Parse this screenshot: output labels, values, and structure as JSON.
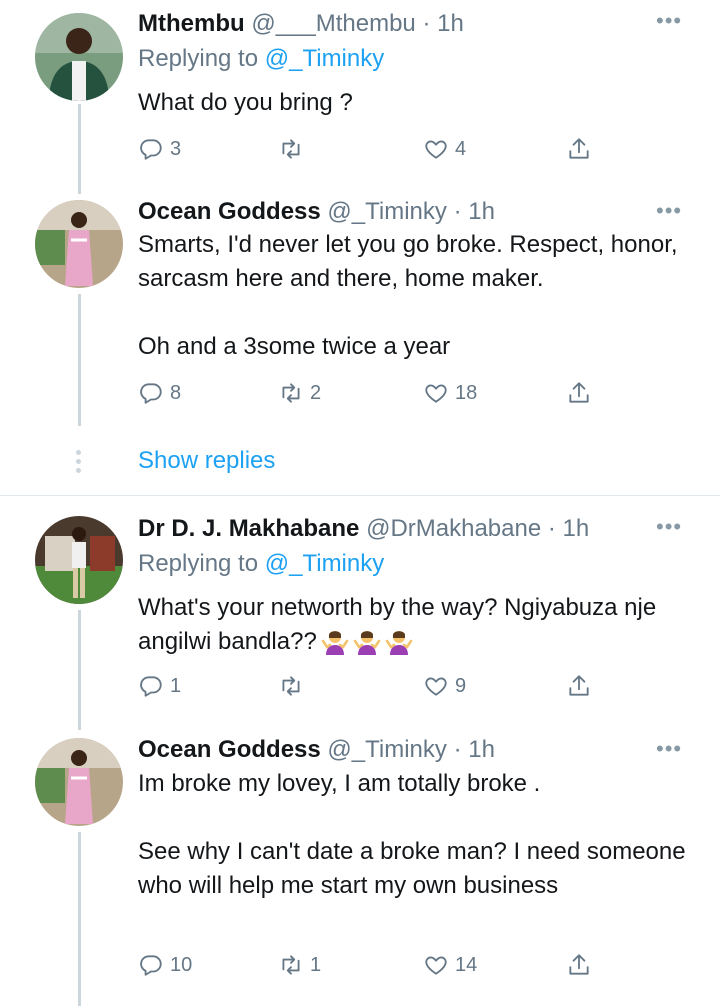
{
  "tweets": [
    {
      "name": "Mthembu",
      "handle": "@___Mthembu",
      "time": "· 1h",
      "replying_label": "Replying to",
      "replying_to": "@_Timinky",
      "text": "What do you bring ?",
      "replies": "3",
      "retweets": "",
      "likes": "4"
    },
    {
      "name": "Ocean Goddess",
      "handle": "@_Timinky",
      "time": "· 1h",
      "text": "Smarts, I'd never let you go broke. Respect, honor, sarcasm here and there, home maker.\n\nOh and a 3some twice a year",
      "replies": "8",
      "retweets": "2",
      "likes": "18"
    },
    {
      "name": "Dr D. J. Makhabane",
      "handle": "@DrMakhabane",
      "time": "· 1h",
      "replying_label": "Replying to",
      "replying_to": "@_Timinky",
      "text": "What's your networth by the way? Ngiyabuza nje angilwi bandla??",
      "replies": "1",
      "retweets": "",
      "likes": "9"
    },
    {
      "name": "Ocean Goddess",
      "handle": "@_Timinky",
      "time": "· 1h",
      "text": "Im broke my lovey, I am totally broke .\n\nSee why I can't date a broke man? I need someone who will help me start my own business",
      "replies": "10",
      "retweets": "1",
      "likes": "14"
    }
  ],
  "show_replies_label": "Show replies",
  "colors": {
    "accent": "#1da1f2",
    "muted": "#657786",
    "line": "#ccd6dd"
  },
  "icons": [
    "reply-icon",
    "retweet-icon",
    "like-icon",
    "share-icon",
    "more-icon",
    "person-shrugging-emoji"
  ]
}
